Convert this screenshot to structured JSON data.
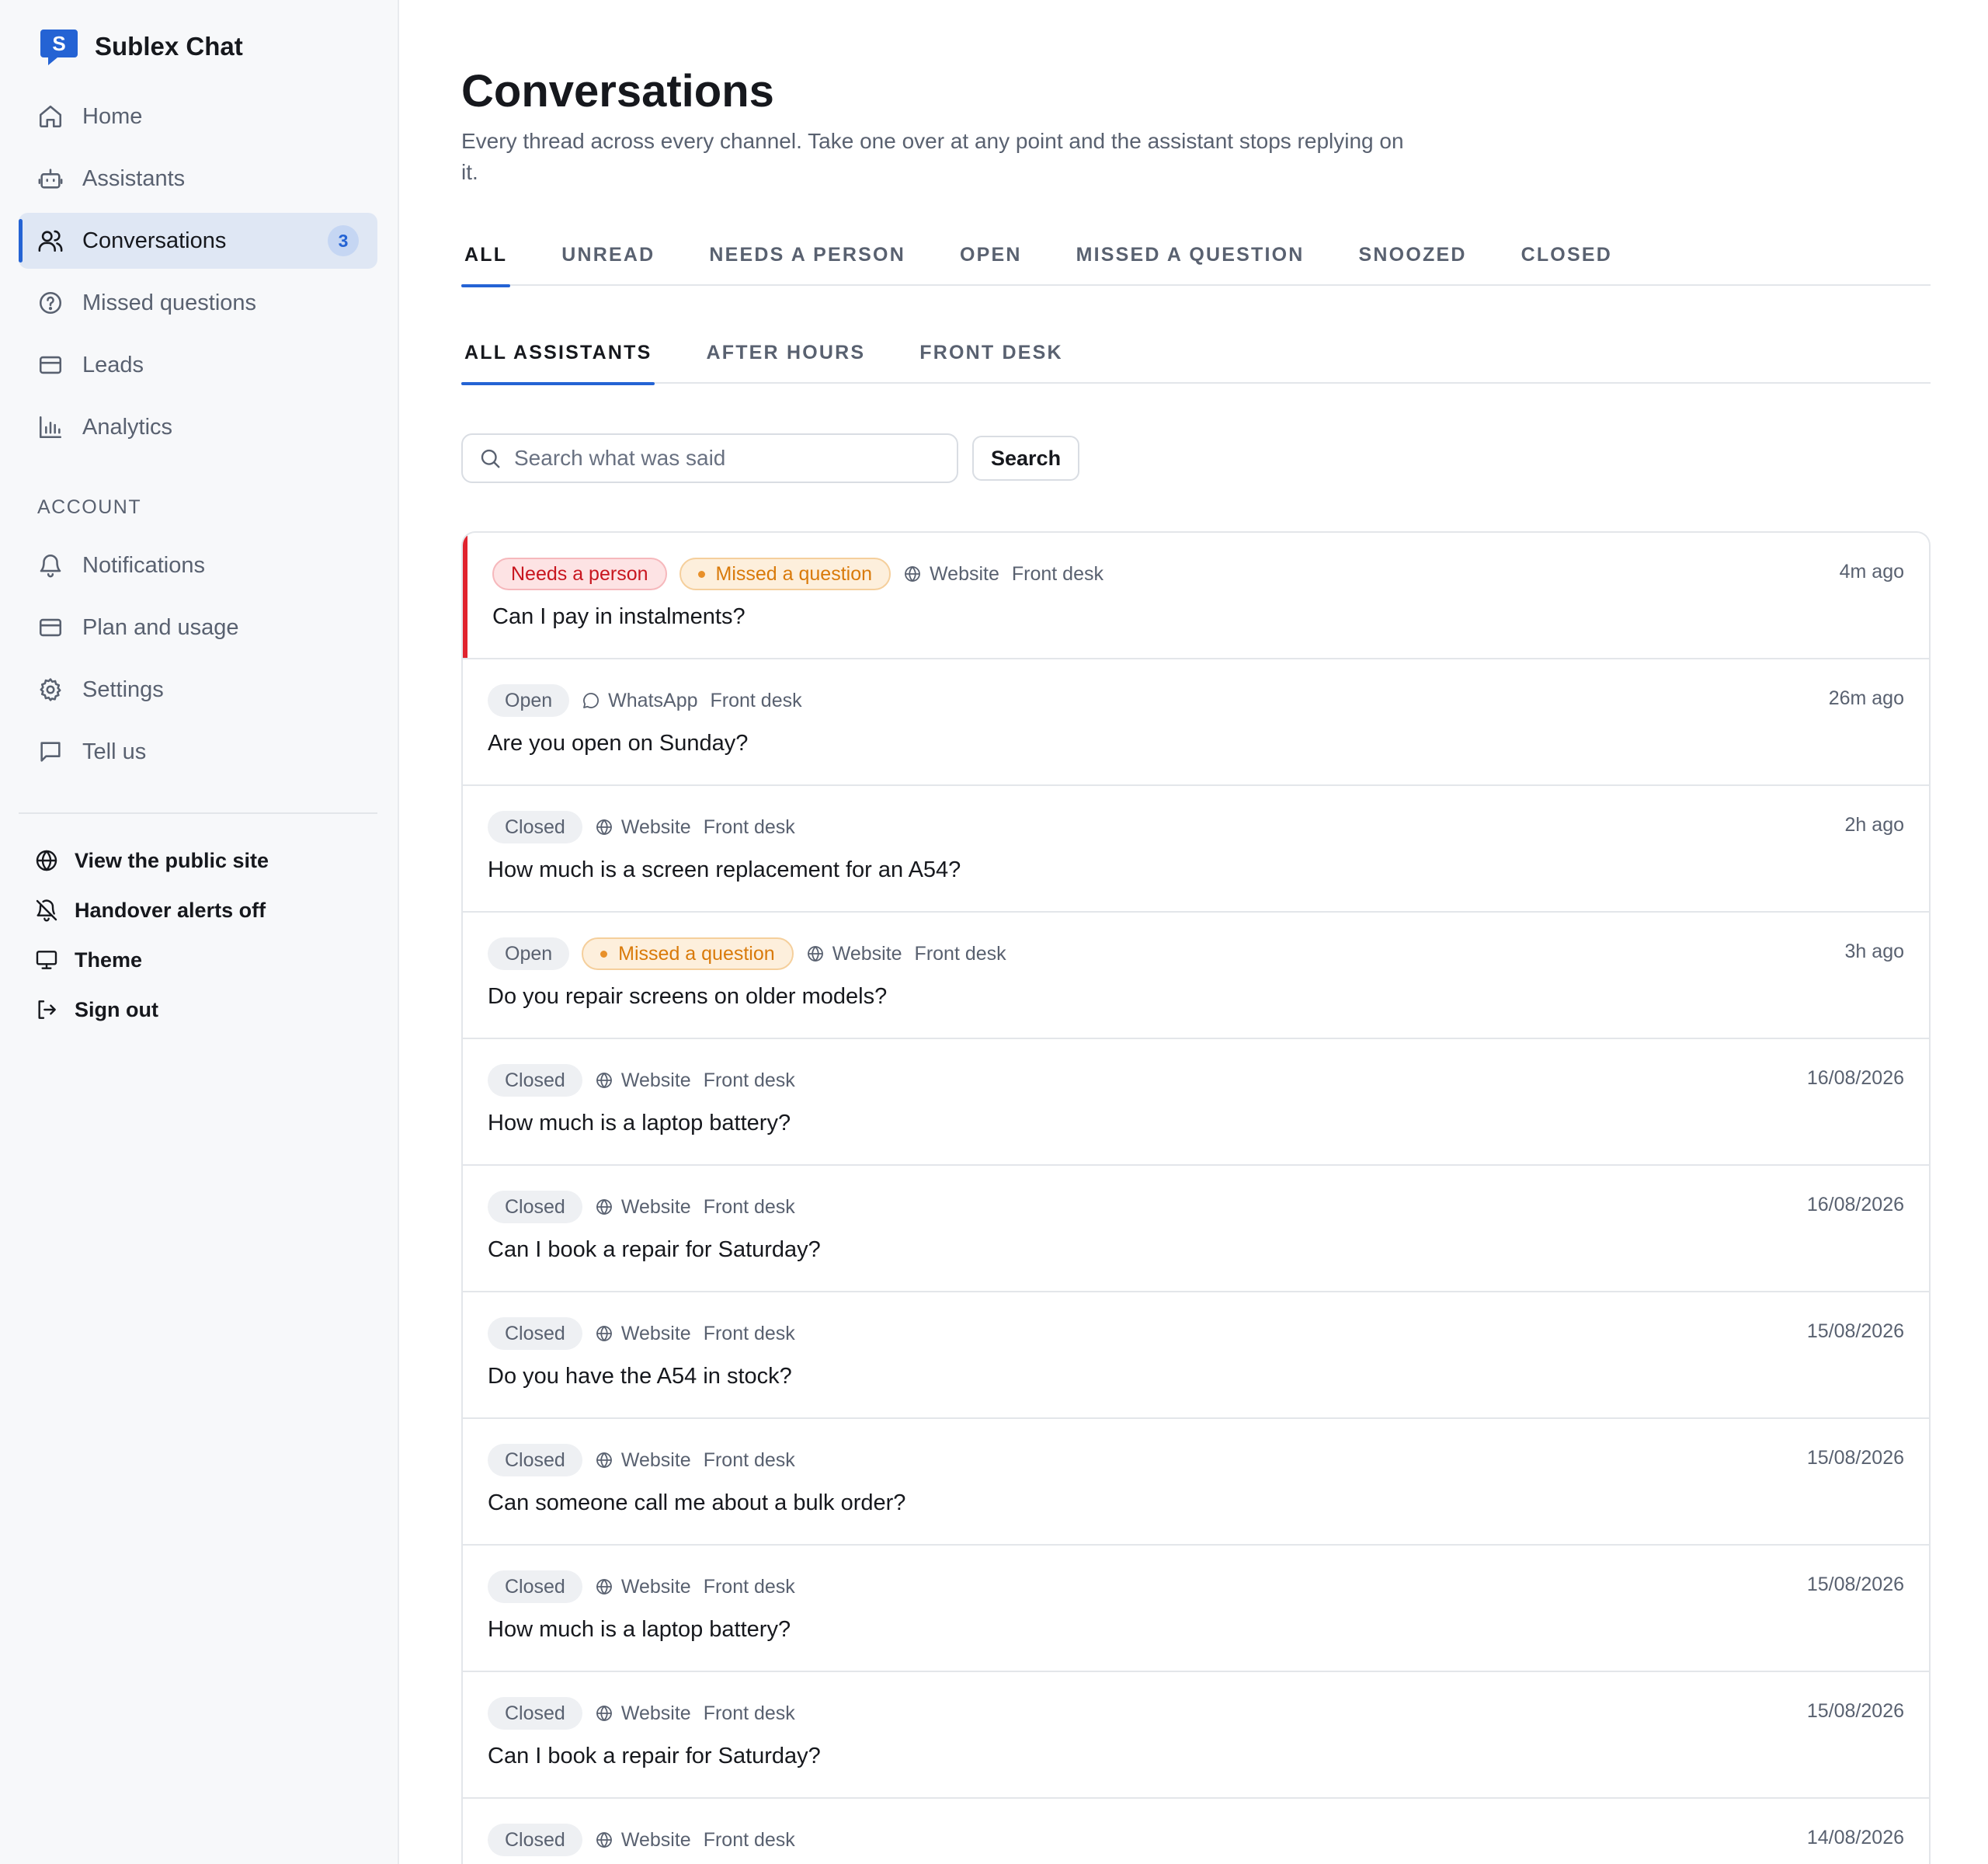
{
  "app": {
    "name": "Sublex Chat",
    "logo_letter": "S",
    "brand_color": "#2463d4"
  },
  "sidebar": {
    "items": [
      {
        "label": "Home",
        "icon": "home-icon"
      },
      {
        "label": "Assistants",
        "icon": "robot-icon"
      },
      {
        "label": "Conversations",
        "icon": "users-icon",
        "badge": "3",
        "active": true
      },
      {
        "label": "Missed questions",
        "icon": "help-circle-icon"
      },
      {
        "label": "Leads",
        "icon": "card-icon"
      },
      {
        "label": "Analytics",
        "icon": "bar-chart-icon"
      }
    ],
    "account_label": "ACCOUNT",
    "account_items": [
      {
        "label": "Notifications",
        "icon": "bell-icon"
      },
      {
        "label": "Plan and usage",
        "icon": "card-icon"
      },
      {
        "label": "Settings",
        "icon": "gear-icon"
      },
      {
        "label": "Tell us",
        "icon": "message-square-icon"
      }
    ],
    "footer_links": [
      {
        "label": "View the public site",
        "icon": "globe-icon"
      },
      {
        "label": "Handover alerts off",
        "icon": "bell-off-icon"
      },
      {
        "label": "Theme",
        "icon": "monitor-icon"
      },
      {
        "label": "Sign out",
        "icon": "sign-out-icon"
      }
    ]
  },
  "main": {
    "title": "Conversations",
    "description": "Every thread across every channel. Take one over at any point and the assistant stops replying on it.",
    "status_tabs": [
      "ALL",
      "UNREAD",
      "NEEDS A PERSON",
      "OPEN",
      "MISSED A QUESTION",
      "SNOOZED",
      "CLOSED"
    ],
    "active_status_tab": 0,
    "assistant_tabs": [
      "ALL ASSISTANTS",
      "AFTER HOURS",
      "FRONT DESK"
    ],
    "active_assistant_tab": 0,
    "search": {
      "placeholder": "Search what was said",
      "value": "",
      "button_label": "Search"
    },
    "conversations": [
      {
        "status": "",
        "needs_person": "Needs a person",
        "missed": "Missed a question",
        "channel": "Website",
        "channel_icon": "globe-icon",
        "assistant": "Front desk",
        "time": "4m ago",
        "question": "Can I pay in instalments?",
        "urgent": true
      },
      {
        "status": "Open",
        "needs_person": "",
        "missed": "",
        "channel": "WhatsApp",
        "channel_icon": "chat-bubble-icon",
        "assistant": "Front desk",
        "time": "26m ago",
        "question": "Are you open on Sunday?"
      },
      {
        "status": "Closed",
        "needs_person": "",
        "missed": "",
        "channel": "Website",
        "channel_icon": "globe-icon",
        "assistant": "Front desk",
        "time": "2h ago",
        "question": "How much is a screen replacement for an A54?"
      },
      {
        "status": "Open",
        "needs_person": "",
        "missed": "Missed a question",
        "channel": "Website",
        "channel_icon": "globe-icon",
        "assistant": "Front desk",
        "time": "3h ago",
        "question": "Do you repair screens on older models?"
      },
      {
        "status": "Closed",
        "needs_person": "",
        "missed": "",
        "channel": "Website",
        "channel_icon": "globe-icon",
        "assistant": "Front desk",
        "time": "16/08/2026",
        "question": "How much is a laptop battery?"
      },
      {
        "status": "Closed",
        "needs_person": "",
        "missed": "",
        "channel": "Website",
        "channel_icon": "globe-icon",
        "assistant": "Front desk",
        "time": "16/08/2026",
        "question": "Can I book a repair for Saturday?"
      },
      {
        "status": "Closed",
        "needs_person": "",
        "missed": "",
        "channel": "Website",
        "channel_icon": "globe-icon",
        "assistant": "Front desk",
        "time": "15/08/2026",
        "question": "Do you have the A54 in stock?"
      },
      {
        "status": "Closed",
        "needs_person": "",
        "missed": "",
        "channel": "Website",
        "channel_icon": "globe-icon",
        "assistant": "Front desk",
        "time": "15/08/2026",
        "question": "Can someone call me about a bulk order?"
      },
      {
        "status": "Closed",
        "needs_person": "",
        "missed": "",
        "channel": "Website",
        "channel_icon": "globe-icon",
        "assistant": "Front desk",
        "time": "15/08/2026",
        "question": "How much is a laptop battery?"
      },
      {
        "status": "Closed",
        "needs_person": "",
        "missed": "",
        "channel": "Website",
        "channel_icon": "globe-icon",
        "assistant": "Front desk",
        "time": "15/08/2026",
        "question": "Can I book a repair for Saturday?"
      },
      {
        "status": "Closed",
        "needs_person": "",
        "missed": "",
        "channel": "Website",
        "channel_icon": "globe-icon",
        "assistant": "Front desk",
        "time": "14/08/2026",
        "question": ""
      }
    ]
  },
  "colors": {
    "accent": "#2463d4",
    "urgent": "#e0232e",
    "needs_person_text": "#c8161f",
    "missed_text": "#d97a0a"
  }
}
